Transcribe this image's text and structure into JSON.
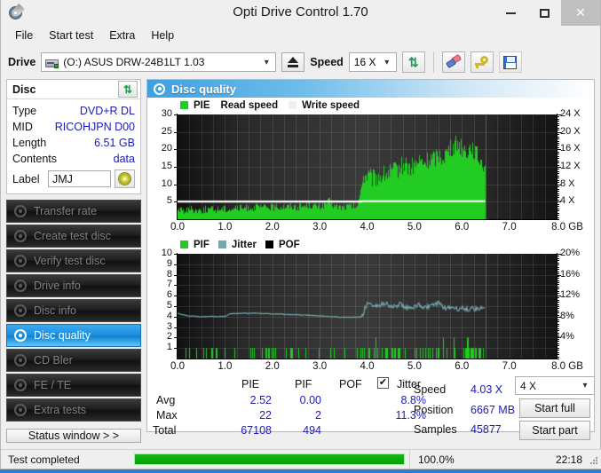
{
  "window": {
    "title": "Opti Drive Control 1.70",
    "icon": "disc-pen-icon",
    "controls": {
      "minimize": "–",
      "maximize": "□",
      "close": "✕"
    }
  },
  "menu": {
    "items": [
      "File",
      "Start test",
      "Extra",
      "Help"
    ]
  },
  "toolbar": {
    "drive_label": "Drive",
    "drive_value": "(O:)   ASUS DRW-24B1LT 1.03",
    "drive_icon": "drive-icon",
    "eject_label": "eject-icon",
    "speed_label": "Speed",
    "speed_value": "16 X",
    "refresh_icon": "refresh-icon",
    "eraser_icon": "eraser-icon",
    "key_icon": "key-icon",
    "save_icon": "save-icon"
  },
  "sidebar": {
    "disc_panel": {
      "title": "Disc",
      "refresh_icon": "refresh-icon",
      "rows": [
        {
          "key": "Type",
          "value": "DVD+R DL"
        },
        {
          "key": "MID",
          "value": "RICOHJPN D00"
        },
        {
          "key": "Length",
          "value": "6.51 GB"
        },
        {
          "key": "Contents",
          "value": "data"
        }
      ],
      "label_key": "Label",
      "label_value": "JMJ",
      "label_placeholder": "",
      "cd_icon": "cd-icon"
    },
    "nav_items": [
      {
        "label": "Transfer rate",
        "icon": "disc-test-icon",
        "active": false
      },
      {
        "label": "Create test disc",
        "icon": "disc-burn-icon",
        "active": false
      },
      {
        "label": "Verify test disc",
        "icon": "disc-verify-icon",
        "active": false
      },
      {
        "label": "Drive info",
        "icon": "drive-info-icon",
        "active": false
      },
      {
        "label": "Disc info",
        "icon": "disc-info-icon",
        "active": false
      },
      {
        "label": "Disc quality",
        "icon": "disc-quality-icon",
        "active": true
      },
      {
        "label": "CD Bler",
        "icon": "cd-bler-icon",
        "active": false
      },
      {
        "label": "FE / TE",
        "icon": "fe-te-icon",
        "active": false
      },
      {
        "label": "Extra tests",
        "icon": "extra-tests-icon",
        "active": false
      }
    ],
    "status_window_button": "Status window > >"
  },
  "main": {
    "panel_title": "Disc quality",
    "panel_icon": "disc-quality-icon",
    "stats": {
      "columns": [
        "PIE",
        "PIF",
        "POF",
        "Jitter"
      ],
      "jitter_checked": true,
      "jitter_check_glyph": "✔",
      "rows": [
        {
          "label": "Avg",
          "pie": "2.52",
          "pif": "0.00",
          "pof": "",
          "jitter": "8.8%"
        },
        {
          "label": "Max",
          "pie": "22",
          "pif": "2",
          "pof": "",
          "jitter": "11.3%"
        },
        {
          "label": "Total",
          "pie": "67108",
          "pif": "494",
          "pof": "",
          "jitter": ""
        }
      ],
      "right": [
        {
          "key": "Speed",
          "value": "4.03 X"
        },
        {
          "key": "Position",
          "value": "6667 MB"
        },
        {
          "key": "Samples",
          "value": "45877"
        }
      ],
      "speed_select": "4 X",
      "start_full": "Start full",
      "start_part": "Start part"
    }
  },
  "statusbar": {
    "message": "Test completed",
    "progress_percent": 100.0,
    "progress_text": "100.0%",
    "time": "22:18"
  },
  "colors": {
    "pie_green": "#22cc22",
    "jitter_teal": "#74a8ad",
    "pof_black": "#000000",
    "marker_red": "#e02020",
    "write_speed_white": "#ffffff",
    "accent_blue": "#1d8fe0",
    "value_blue": "#1b1bb5"
  },
  "chart_data": [
    {
      "type": "area",
      "title": "Disc quality",
      "legend": [
        {
          "label": "PIE",
          "color": "#22cc22",
          "swatch": true
        },
        {
          "label": "Read speed",
          "color": "#ffffff",
          "swatch": false
        },
        {
          "label": "Write speed",
          "color": "#ffffff",
          "swatch": true
        }
      ],
      "legend_position": "top-left",
      "xlabel": "GB",
      "ylabel": "PIE",
      "y2label": "X",
      "xlim": [
        0.0,
        8.0
      ],
      "ylim": [
        0,
        30
      ],
      "y2lim": [
        0,
        24
      ],
      "xticks": [
        "0.0",
        "1.0",
        "2.0",
        "3.0",
        "4.0",
        "5.0",
        "6.0",
        "7.0",
        "8.0 GB"
      ],
      "yticks": [
        "30",
        "25",
        "20",
        "15",
        "10",
        "5"
      ],
      "y2ticks": [
        "24 X",
        "20 X",
        "16 X",
        "12 X",
        "8 X",
        "4 X"
      ],
      "grid": true,
      "marker_x": 6.5,
      "series": [
        {
          "name": "PIE",
          "color": "#22cc22",
          "x": [
            0.0,
            0.1,
            0.2,
            0.3,
            0.4,
            0.5,
            0.6,
            0.7,
            0.8,
            0.9,
            1.0,
            1.1,
            1.2,
            1.3,
            1.4,
            1.5,
            1.6,
            1.7,
            1.8,
            1.9,
            2.0,
            2.1,
            2.2,
            2.3,
            2.4,
            2.5,
            2.6,
            2.7,
            2.8,
            2.9,
            3.0,
            3.1,
            3.2,
            3.3,
            3.4,
            3.5,
            3.6,
            3.7,
            3.8,
            3.9,
            4.0,
            4.1,
            4.2,
            4.3,
            4.4,
            4.5,
            4.6,
            4.7,
            4.8,
            4.9,
            5.0,
            5.1,
            5.2,
            5.3,
            5.4,
            5.5,
            5.6,
            5.7,
            5.8,
            5.9,
            6.0,
            6.1,
            6.2,
            6.3,
            6.4,
            6.5
          ],
          "values": [
            2.2,
            1.8,
            2.0,
            2.3,
            2.0,
            1.9,
            2.2,
            2.1,
            2.0,
            2.4,
            2.3,
            2.2,
            2.6,
            2.4,
            2.5,
            2.7,
            2.6,
            2.8,
            2.6,
            2.9,
            2.7,
            2.8,
            3.0,
            2.9,
            3.1,
            2.8,
            3.0,
            3.2,
            3.4,
            3.0,
            2.9,
            3.6,
            4.5,
            3.0,
            2.8,
            2.7,
            3.0,
            2.9,
            2.8,
            11.5,
            12.0,
            11.0,
            11.5,
            12.0,
            12.5,
            13.0,
            13.5,
            14.5,
            15.5,
            14.0,
            15.0,
            16.0,
            15.5,
            16.5,
            17.0,
            18.0,
            17.5,
            19.0,
            20.0,
            21.5,
            20.0,
            19.0,
            20.5,
            18.0,
            16.0,
            15.5
          ]
        },
        {
          "name": "Read speed",
          "color": "#ffffff",
          "x": [
            0.0,
            0.5,
            1.0,
            1.5,
            2.0,
            2.5,
            3.0,
            3.5,
            3.9,
            4.0,
            4.5,
            5.0,
            5.5,
            6.0,
            6.5
          ],
          "values": [
            4.03,
            4.03,
            4.03,
            4.03,
            4.03,
            4.03,
            4.03,
            4.03,
            4.03,
            4.05,
            4.05,
            4.05,
            4.05,
            4.05,
            4.05
          ]
        }
      ]
    },
    {
      "type": "area",
      "legend": [
        {
          "label": "PIF",
          "color": "#22cc22",
          "swatch": true
        },
        {
          "label": "Jitter",
          "color": "#74a8ad",
          "swatch": true
        },
        {
          "label": "POF",
          "color": "#000000",
          "swatch": true
        }
      ],
      "legend_position": "top-left",
      "xlabel": "GB",
      "ylabel": "PIF",
      "y2label": "%",
      "xlim": [
        0.0,
        8.0
      ],
      "ylim": [
        0,
        10
      ],
      "y2lim": [
        0,
        20
      ],
      "xticks": [
        "0.0",
        "1.0",
        "2.0",
        "3.0",
        "4.0",
        "5.0",
        "6.0",
        "7.0",
        "8.0 GB"
      ],
      "yticks": [
        "10",
        "9",
        "8",
        "7",
        "6",
        "5",
        "4",
        "3",
        "2",
        "1"
      ],
      "y2ticks": [
        "20%",
        "16%",
        "12%",
        "8%",
        "4%"
      ],
      "grid": true,
      "marker_x": 6.5,
      "series": [
        {
          "name": "Jitter",
          "color": "#74a8ad",
          "x": [
            0.0,
            0.1,
            0.2,
            0.3,
            0.4,
            0.5,
            0.6,
            0.7,
            0.8,
            0.9,
            1.0,
            1.1,
            1.2,
            1.3,
            1.4,
            1.5,
            1.6,
            1.7,
            1.8,
            1.9,
            2.0,
            2.1,
            2.2,
            2.3,
            2.4,
            2.5,
            2.6,
            2.7,
            2.8,
            2.9,
            3.0,
            3.1,
            3.2,
            3.3,
            3.4,
            3.5,
            3.6,
            3.7,
            3.8,
            3.9,
            4.0,
            4.1,
            4.2,
            4.3,
            4.4,
            4.5,
            4.6,
            4.7,
            4.8,
            4.9,
            5.0,
            5.1,
            5.2,
            5.3,
            5.4,
            5.5,
            5.6,
            5.7,
            5.8,
            5.9,
            6.0,
            6.1,
            6.2,
            6.3,
            6.4,
            6.5
          ],
          "values": [
            8.6,
            8.4,
            8.2,
            8.1,
            8.1,
            8.0,
            8.0,
            8.1,
            8.0,
            8.1,
            8.0,
            8.5,
            8.6,
            8.6,
            8.7,
            8.6,
            8.7,
            8.6,
            8.6,
            8.6,
            8.5,
            8.5,
            8.5,
            8.4,
            8.4,
            8.4,
            8.3,
            8.3,
            8.2,
            8.2,
            8.1,
            8.1,
            8.0,
            8.0,
            7.9,
            7.9,
            7.9,
            7.9,
            7.9,
            8.0,
            10.8,
            10.2,
            10.0,
            10.4,
            10.6,
            10.0,
            9.8,
            10.6,
            9.6,
            10.0,
            9.8,
            10.4,
            9.6,
            10.0,
            10.2,
            10.6,
            9.8,
            9.6,
            9.8,
            9.4,
            9.6,
            9.4,
            9.6,
            9.5,
            9.6,
            9.7
          ]
        },
        {
          "name": "PIF",
          "color": "#22cc22",
          "note": "sparse spikes of 1 to 2 across full scan span 0.0 to 6.5 GB, denser after 3.8 GB"
        }
      ]
    }
  ]
}
